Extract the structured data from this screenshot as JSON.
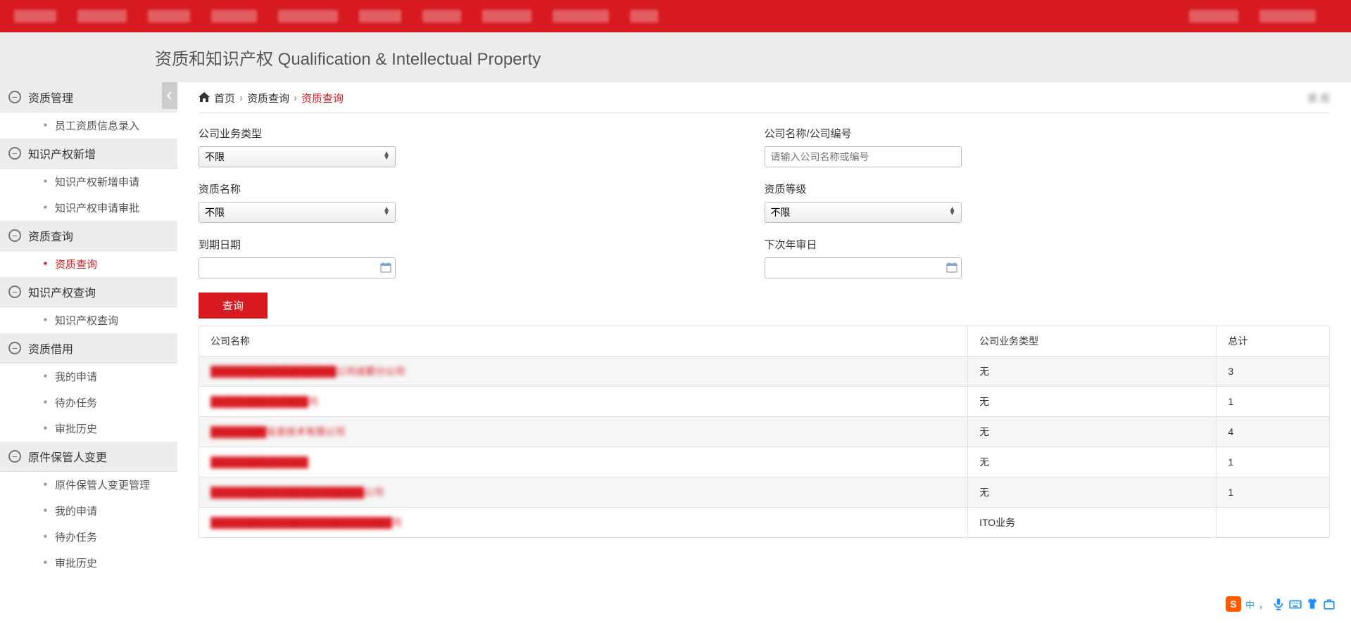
{
  "page_title": "资质和知识产权 Qualification & Intellectual Property",
  "breadcrumb": {
    "home": "首页",
    "lv1": "资质查询",
    "lv2": "资质查询",
    "right": "第 周"
  },
  "sidebar": {
    "groups": [
      {
        "label": "资质管理",
        "items": [
          {
            "label": "员工资质信息录入",
            "active": false
          }
        ]
      },
      {
        "label": "知识产权新增",
        "items": [
          {
            "label": "知识产权新增申请",
            "active": false
          },
          {
            "label": "知识产权申请审批",
            "active": false
          }
        ]
      },
      {
        "label": "资质查询",
        "items": [
          {
            "label": "资质查询",
            "active": true
          }
        ]
      },
      {
        "label": "知识产权查询",
        "items": [
          {
            "label": "知识产权查询",
            "active": false
          }
        ]
      },
      {
        "label": "资质借用",
        "items": [
          {
            "label": "我的申请",
            "active": false
          },
          {
            "label": "待办任务",
            "active": false
          },
          {
            "label": "审批历史",
            "active": false
          }
        ]
      },
      {
        "label": "原件保管人变更",
        "items": [
          {
            "label": "原件保管人变更管理",
            "active": false
          },
          {
            "label": "我的申请",
            "active": false
          },
          {
            "label": "待办任务",
            "active": false
          },
          {
            "label": "审批历史",
            "active": false
          }
        ]
      }
    ]
  },
  "form": {
    "businessType": {
      "label": "公司业务类型",
      "value": "不限"
    },
    "companyName": {
      "label": "公司名称/公司编号",
      "placeholder": "请输入公司名称或编号",
      "value": ""
    },
    "qualName": {
      "label": "资质名称",
      "value": "不限"
    },
    "qualLevel": {
      "label": "资质等级",
      "value": "不限"
    },
    "expireDate": {
      "label": "到期日期",
      "value": ""
    },
    "nextReview": {
      "label": "下次年审日",
      "value": ""
    },
    "queryBtn": "查询"
  },
  "table": {
    "headers": {
      "company": "公司名称",
      "biz": "公司业务类型",
      "total": "总计"
    },
    "rows": [
      {
        "company": "██████████████████公司成都分公司",
        "biz": "无",
        "total": "3"
      },
      {
        "company": "██████████████司",
        "biz": "无",
        "total": "1"
      },
      {
        "company": "████████信息技术有限公司",
        "biz": "无",
        "total": "4"
      },
      {
        "company": "██████████████",
        "biz": "无",
        "total": "1"
      },
      {
        "company": "██████████████████████公司",
        "biz": "无",
        "total": "1"
      },
      {
        "company": "██████████████████████████司",
        "biz": "ITO业务",
        "total": ""
      }
    ]
  },
  "ime": {
    "text": "中"
  }
}
